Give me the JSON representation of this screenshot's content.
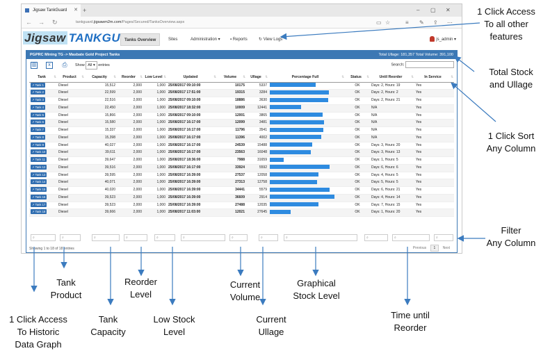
{
  "browser": {
    "tab_title": "Jigsaw TankGuard",
    "url_prefix": "tankguard.",
    "url_domain": "jigsawm2m.com",
    "url_path": "/Pages/Secured/TanksOverview.aspx"
  },
  "app": {
    "logo_jigsaw": "Jigsaw",
    "logo_tankguard": "TANKGUARD",
    "nav": [
      "Tanks Overview",
      "Sites",
      "Administration ▾",
      "Reports",
      "View Logs"
    ],
    "user": "js_admin ▾"
  },
  "panel": {
    "title": "PGPRC Mining TG -> Masbate Gold Project Tanks",
    "totals": "Total Ullage: 181,357    Total Volume: 391,100",
    "show_label": "Show",
    "show_value": "All",
    "entries_label": "entries",
    "search_label": "Search:",
    "columns": [
      "Tank",
      "Product",
      "Capacity",
      "Reorder",
      "Low Level",
      "Updated",
      "Volume",
      "Ullage",
      "Percentage Full",
      "Status",
      "Until Reorder",
      "In Service"
    ],
    "rows": [
      {
        "tank": "Tank 1",
        "product": "Diesel",
        "capacity": "15,512",
        "reorder": "2,000",
        "low": "1,000",
        "updated": "25/08/2017 09:10:00",
        "volume": "10175",
        "ullage": "5337",
        "pct": 0.66,
        "status": "OK",
        "until": "Days: 2, Hours: 19",
        "service": "Yes"
      },
      {
        "tank": "Tank 2",
        "product": "Diesel",
        "capacity": "22,599",
        "reorder": "2,000",
        "low": "1,000",
        "updated": "25/08/2017 17:51:00",
        "volume": "19315",
        "ullage": "3284",
        "pct": 0.85,
        "status": "OK",
        "until": "Days: 2, Hours: 2",
        "service": "Yes"
      },
      {
        "tank": "Tank 3",
        "product": "Diesel",
        "capacity": "22,516",
        "reorder": "2,000",
        "low": "1,000",
        "updated": "25/08/2017 09:10:00",
        "volume": "18886",
        "ullage": "3630",
        "pct": 0.84,
        "status": "OK",
        "until": "Days: 2, Hours: 21",
        "service": "Yes"
      },
      {
        "tank": "Tank 4",
        "product": "Diesel",
        "capacity": "22,450",
        "reorder": "2,000",
        "low": "1,000",
        "updated": "25/08/2017 18:32:00",
        "volume": "10009",
        "ullage": "12441",
        "pct": 0.45,
        "status": "OK",
        "until": "N/A",
        "service": "Yes"
      },
      {
        "tank": "Tank 5",
        "product": "Diesel",
        "capacity": "15,866",
        "reorder": "2,000",
        "low": "1,000",
        "updated": "25/08/2017 09:10:00",
        "volume": "12001",
        "ullage": "3865",
        "pct": 0.76,
        "status": "OK",
        "until": "N/A",
        "service": "Yes"
      },
      {
        "tank": "Tank 6",
        "product": "Diesel",
        "capacity": "15,580",
        "reorder": "2,000",
        "low": "1,000",
        "updated": "25/08/2017 16:17:00",
        "volume": "12099",
        "ullage": "3481",
        "pct": 0.78,
        "status": "OK",
        "until": "N/A",
        "service": "Yes"
      },
      {
        "tank": "Tank 7",
        "product": "Diesel",
        "capacity": "15,337",
        "reorder": "2,000",
        "low": "1,000",
        "updated": "25/08/2017 16:17:00",
        "volume": "11796",
        "ullage": "3541",
        "pct": 0.77,
        "status": "OK",
        "until": "N/A",
        "service": "Yes"
      },
      {
        "tank": "Tank 8",
        "product": "Diesel",
        "capacity": "15,398",
        "reorder": "2,000",
        "low": "1,000",
        "updated": "25/08/2017 16:17:00",
        "volume": "11396",
        "ullage": "4002",
        "pct": 0.74,
        "status": "OK",
        "until": "N/A",
        "service": "Yes"
      },
      {
        "tank": "Tank 9",
        "product": "Diesel",
        "capacity": "40,027",
        "reorder": "2,000",
        "low": "1,000",
        "updated": "25/08/2017 16:17:00",
        "volume": "24539",
        "ullage": "15488",
        "pct": 0.61,
        "status": "OK",
        "until": "Days: 3, Hours: 20",
        "service": "Yes"
      },
      {
        "tank": "Tank 10",
        "product": "Diesel",
        "capacity": "39,611",
        "reorder": "2,000",
        "low": "1,000",
        "updated": "25/08/2017 16:17:00",
        "volume": "23563",
        "ullage": "16048",
        "pct": 0.59,
        "status": "OK",
        "until": "Days: 3, Hours: 13",
        "service": "Yes"
      },
      {
        "tank": "Tank 11",
        "product": "Diesel",
        "capacity": "39,647",
        "reorder": "2,000",
        "low": "1,000",
        "updated": "25/08/2017 18:36:00",
        "volume": "7988",
        "ullage": "31659",
        "pct": 0.2,
        "status": "OK",
        "until": "Days: 1, Hours: 5",
        "service": "Yes"
      },
      {
        "tank": "Tank 12",
        "product": "Diesel",
        "capacity": "39,516",
        "reorder": "2,000",
        "low": "1,000",
        "updated": "25/08/2017 16:17:00",
        "volume": "33924",
        "ullage": "5592",
        "pct": 0.86,
        "status": "OK",
        "until": "Days: 6, Hours: 6",
        "service": "Yes"
      },
      {
        "tank": "Tank 13",
        "product": "Diesel",
        "capacity": "39,595",
        "reorder": "2,000",
        "low": "1,000",
        "updated": "25/08/2017 16:39:00",
        "volume": "27537",
        "ullage": "12058",
        "pct": 0.7,
        "status": "OK",
        "until": "Days: 4, Hours: 5",
        "service": "Yes"
      },
      {
        "tank": "Tank 14",
        "product": "Diesel",
        "capacity": "40,071",
        "reorder": "2,000",
        "low": "1,000",
        "updated": "25/08/2017 16:39:00",
        "volume": "27313",
        "ullage": "12758",
        "pct": 0.68,
        "status": "OK",
        "until": "Days: 5, Hours: 5",
        "service": "Yes"
      },
      {
        "tank": "Tank 15",
        "product": "Diesel",
        "capacity": "40,020",
        "reorder": "2,000",
        "low": "1,000",
        "updated": "25/08/2017 16:39:00",
        "volume": "34441",
        "ullage": "5579",
        "pct": 0.86,
        "status": "OK",
        "until": "Days: 6, Hours: 21",
        "service": "Yes"
      },
      {
        "tank": "Tank 16",
        "product": "Diesel",
        "capacity": "39,523",
        "reorder": "2,000",
        "low": "1,000",
        "updated": "25/08/2017 16:39:00",
        "volume": "36609",
        "ullage": "2914",
        "pct": 0.93,
        "status": "OK",
        "until": "Days: 4, Hours: 14",
        "service": "Yes"
      },
      {
        "tank": "Tank 17",
        "product": "Diesel",
        "capacity": "39,523",
        "reorder": "2,000",
        "low": "1,000",
        "updated": "25/08/2017 16:39:00",
        "volume": "27488",
        "ullage": "12035",
        "pct": 0.7,
        "status": "OK",
        "until": "Days: 7, Hours: 15",
        "service": "Yes"
      },
      {
        "tank": "Tank 18",
        "product": "Diesel",
        "capacity": "39,666",
        "reorder": "2,000",
        "low": "1,000",
        "updated": "25/08/2017 11:03:00",
        "volume": "12021",
        "ullage": "27645",
        "pct": 0.3,
        "status": "OK",
        "until": "Days: 1, Hours: 20",
        "service": "Yes"
      }
    ],
    "info": "Showing 1 to 18 of 18 entries",
    "pager": {
      "prev": "Previous",
      "page": "1",
      "next": "Next"
    }
  },
  "annotations": {
    "all_features": "1 Click Access\nTo all other\nfeatures",
    "totals": "Total Stock\nand Ullage",
    "sort": "1 Click Sort\nAny Column",
    "filter": "Filter\nAny Column",
    "tank_product": "Tank\nProduct",
    "reorder_level": "Reorder\nLevel",
    "current_volume": "Current\nVolume",
    "graphical": "Graphical\nStock Level",
    "historic": "1 Click Access\nTo Historic\nData Graph",
    "tank_capacity": "Tank\nCapacity",
    "low_stock": "Low Stock\nLevel",
    "current_ullage": "Current\nUllage",
    "time_reorder": "Time until\nReorder"
  }
}
